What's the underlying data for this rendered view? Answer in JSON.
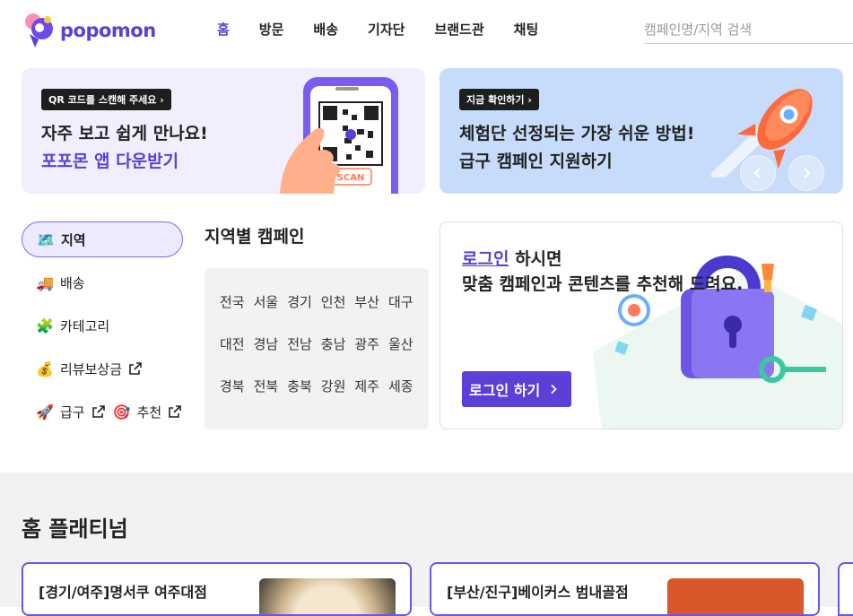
{
  "header": {
    "logo_text": "popomon",
    "nav": [
      "홈",
      "방문",
      "배송",
      "기자단",
      "브랜드관",
      "채팅"
    ],
    "active_nav": "홈",
    "search_placeholder": "캠페인명/지역 검색"
  },
  "banners": [
    {
      "tag": "QR 코드를 스캔해 주세요",
      "line1": "자주 보고 쉽게 만나요!",
      "line2": "포포몬 앱 다운받기",
      "image_text": "SCAN"
    },
    {
      "tag": "지금 확인하기",
      "line1": "체험단 선정되는 가장 쉬운 방법!",
      "line2": "급구 캠페인 지원하기"
    }
  ],
  "sidebar": {
    "items": [
      {
        "emoji": "🗺️",
        "label": "지역",
        "active": true,
        "external": false
      },
      {
        "emoji": "🚚",
        "label": "배송",
        "active": false,
        "external": false
      },
      {
        "emoji": "🧩",
        "label": "카테고리",
        "active": false,
        "external": false
      },
      {
        "emoji": "💰",
        "label": "리뷰보상금",
        "active": false,
        "external": true
      }
    ],
    "last_row": [
      {
        "emoji": "🚀",
        "label": "급구",
        "external": true
      },
      {
        "emoji": "🎯",
        "label": "추천",
        "external": true
      }
    ]
  },
  "region": {
    "title": "지역별 캠페인",
    "regions": [
      "전국",
      "서울",
      "경기",
      "인천",
      "부산",
      "대구",
      "대전",
      "경남",
      "전남",
      "충남",
      "광주",
      "울산",
      "경북",
      "전북",
      "충북",
      "강원",
      "제주",
      "세종"
    ]
  },
  "login_card": {
    "link": "로그인",
    "line1_rest": " 하시면",
    "line2": "맞춤 캠페인과 콘텐츠를 추천해 드려요.",
    "button": "로그인 하기"
  },
  "platinum": {
    "title": "홈 플래티넘",
    "cards": [
      {
        "title": "[경기/여주]명서쿠 여주대점"
      },
      {
        "title": "[부산/진구]베이커스 범내골점"
      }
    ]
  },
  "colors": {
    "brand": "#5b3fd6",
    "banner1_bg": "#f1eefd",
    "banner2_bg": "#c7dcfb",
    "section_bg": "#f2f2f4"
  }
}
